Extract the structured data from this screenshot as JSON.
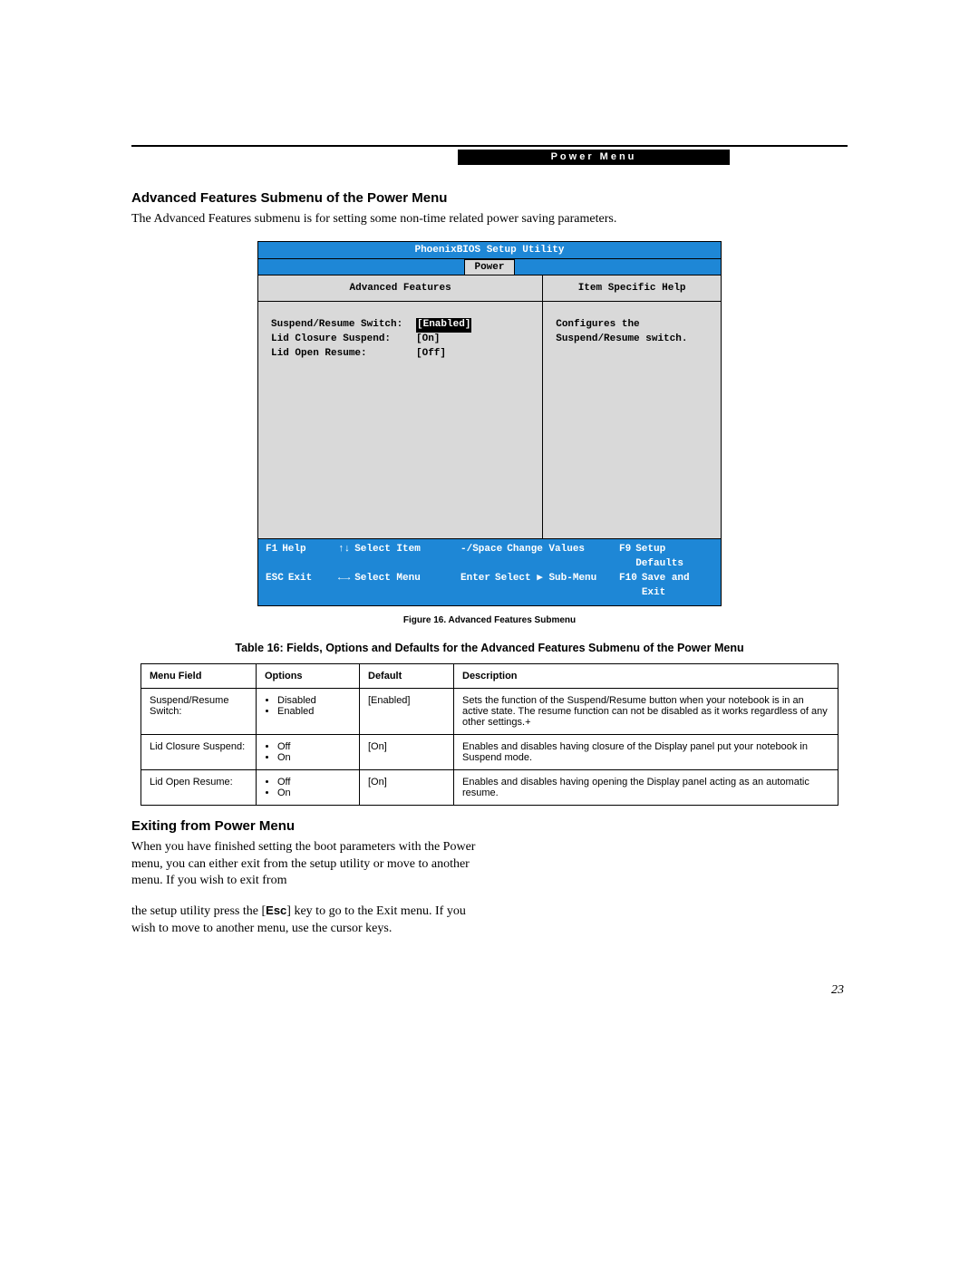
{
  "header_bar": "Power Menu",
  "section_title": "Advanced Features Submenu of the Power Menu",
  "section_para": "The Advanced Features submenu is for setting some non-time related power saving parameters.",
  "bios": {
    "title": "PhoenixBIOS Setup Utility",
    "tab": "Power",
    "left_header": "Advanced Features",
    "right_header": "Item Specific Help",
    "rows": [
      {
        "label": "Suspend/Resume Switch:",
        "value": "[Enabled]",
        "highlight": true
      },
      {
        "label": "Lid Closure Suspend:",
        "value": "[On]",
        "highlight": false
      },
      {
        "label": "Lid Open Resume:",
        "value": "[Off]",
        "highlight": false
      }
    ],
    "help_line1": "Configures the",
    "help_line2": "Suspend/Resume switch.",
    "footer": {
      "r1": {
        "k1": "F1",
        "t1": "Help",
        "k2": "↑↓",
        "t2": "Select Item",
        "k3": "-/Space",
        "t3": "Change Values",
        "k4": "F9",
        "t4": "Setup Defaults"
      },
      "r2": {
        "k1": "ESC",
        "t1": "Exit",
        "k2": "←→",
        "t2": "Select Menu",
        "k3": "Enter",
        "t3": "Select ▶ Sub-Menu",
        "k4": "F10",
        "t4": "Save and Exit"
      }
    }
  },
  "figure_caption": "Figure 16.  Advanced Features Submenu",
  "table_caption": "Table 16: Fields, Options and Defaults for the Advanced Features Submenu of the Power Menu",
  "table": {
    "headers": {
      "field": "Menu Field",
      "options": "Options",
      "def": "Default",
      "desc": "Description"
    },
    "rows": [
      {
        "field": "Suspend/Resume Switch:",
        "options": [
          "Disabled",
          "Enabled"
        ],
        "def": "[Enabled]",
        "desc": "Sets the function of the Suspend/Resume button when your notebook is in an active state. The resume function can not be disabled as it works regardless of any other settings.+"
      },
      {
        "field": "Lid Closure Suspend:",
        "options": [
          "Off",
          "On"
        ],
        "def": "[On]",
        "desc": "Enables and disables having closure of the Display panel put your notebook in Suspend mode."
      },
      {
        "field": "Lid Open Resume:",
        "options": [
          "Off",
          "On"
        ],
        "def": "[On]",
        "desc": "Enables and disables having opening the Display panel acting as an automatic resume."
      }
    ]
  },
  "exit": {
    "heading": "Exiting from Power Menu",
    "p1": "When you have finished setting the boot parameters with the Power menu, you can either exit from the setup utility or move to another menu. If you wish to exit from",
    "p2a": "the setup utility press the [",
    "esc": "Esc",
    "p2b": "] key to go to the Exit menu. If you wish to move to another menu, use the cursor keys."
  },
  "page_number": "23"
}
